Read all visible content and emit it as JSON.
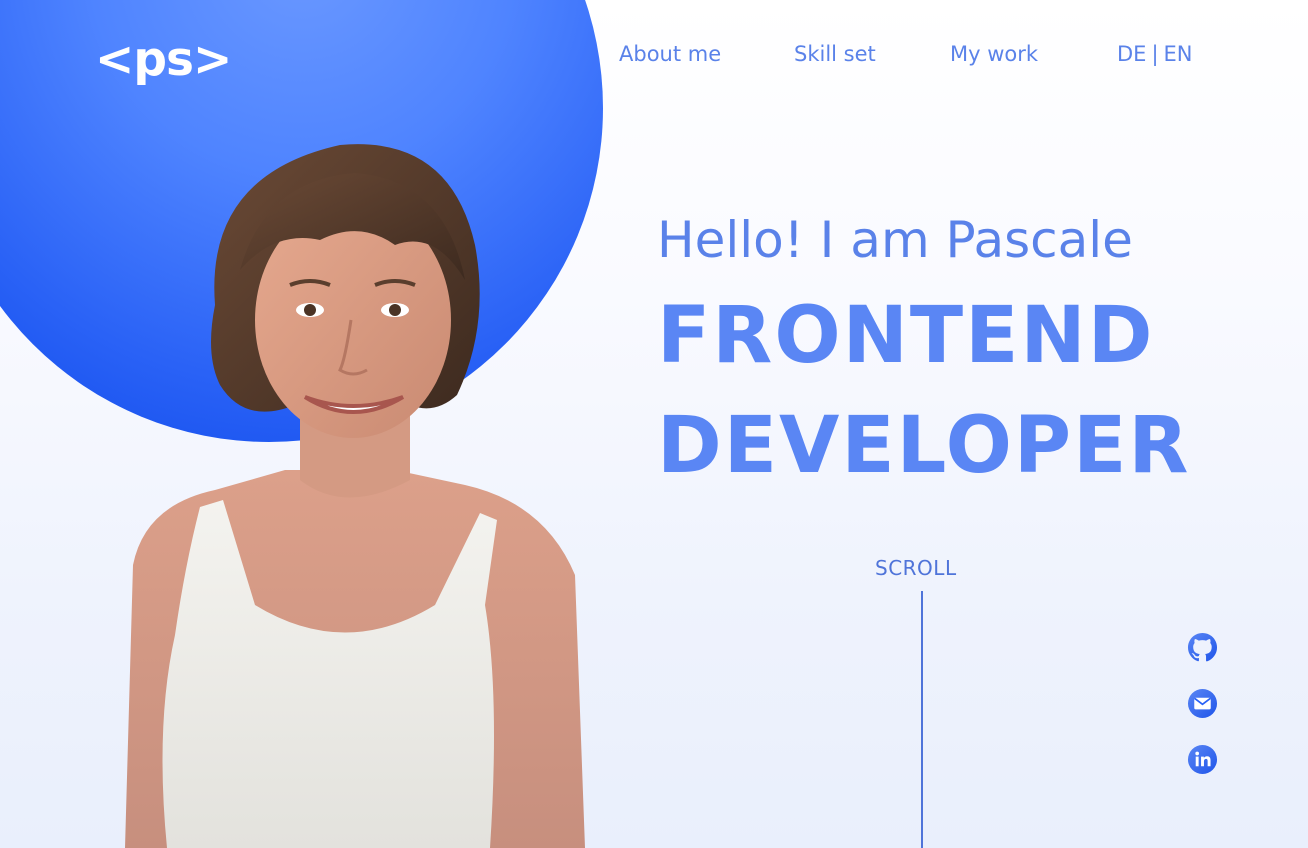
{
  "logo": {
    "text": "<ps>"
  },
  "nav": {
    "items": [
      {
        "label": "About me"
      },
      {
        "label": "Skill set"
      },
      {
        "label": "My work"
      }
    ],
    "language": {
      "de": "DE",
      "separator": "|",
      "en": "EN"
    }
  },
  "hero": {
    "greeting": "Hello! I am Pascale",
    "title_line1": "FRONTEND",
    "title_line2": "DEVELOPER"
  },
  "scroll": {
    "label": "SCROLL"
  },
  "social": {
    "icons": [
      "github-icon",
      "mail-icon",
      "linkedin-icon"
    ]
  },
  "colors": {
    "accent": "#5a82e9",
    "circle": "#2a62f6",
    "headline": "#5a86f4"
  }
}
